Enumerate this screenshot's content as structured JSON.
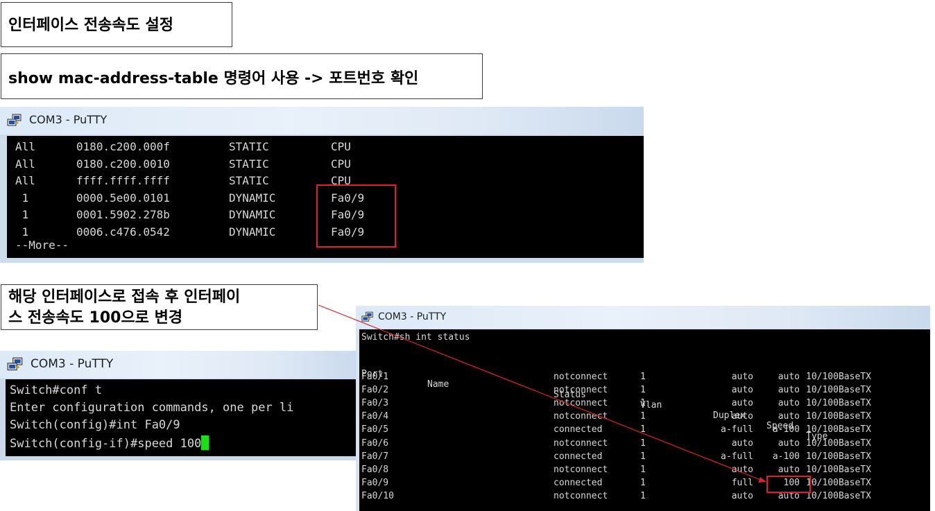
{
  "labels": {
    "title": "인터페이스 전송속도 설정",
    "show_cmd": "show mac-address-table 명령어 사용 -> 포트번호 확인",
    "step_line1": "해당 인터페이스로 접속 후 인터페이",
    "step_line2": "스 전송속도 100으로 변경"
  },
  "window_title": "COM3 - PuTTY",
  "colors": {
    "highlight_box": "#e0202a",
    "cursor": "#19e019",
    "terminal_bg": "#000000",
    "terminal_fg": "#d8d8d8"
  },
  "mac_table": {
    "rows": [
      {
        "vlan": "All",
        "mac": "0180.c200.000f",
        "type": "STATIC",
        "port": "CPU"
      },
      {
        "vlan": "All",
        "mac": "0180.c200.0010",
        "type": "STATIC",
        "port": "CPU"
      },
      {
        "vlan": "All",
        "mac": "ffff.ffff.ffff",
        "type": "STATIC",
        "port": "CPU"
      },
      {
        "vlan": " 1",
        "mac": "0000.5e00.0101",
        "type": "DYNAMIC",
        "port": "Fa0/9"
      },
      {
        "vlan": " 1",
        "mac": "0001.5902.278b",
        "type": "DYNAMIC",
        "port": "Fa0/9"
      },
      {
        "vlan": " 1",
        "mac": "0006.c476.0542",
        "type": "DYNAMIC",
        "port": "Fa0/9"
      }
    ],
    "more": "--More--"
  },
  "config_session": {
    "lines": [
      "Switch#conf t",
      "Enter configuration commands, one per li",
      "Switch(config)#int Fa0/9",
      "Switch(config-if)#speed 100"
    ]
  },
  "int_status": {
    "command": "Switch#sh int status",
    "headers": {
      "port": "Port",
      "name": "Name",
      "status": "Status",
      "vlan": "Vlan",
      "duplex": "Duplex",
      "speed": "Speed",
      "type": "Type"
    },
    "rows": [
      {
        "port": "Fa0/1",
        "status": "notconnect",
        "vlan": "1",
        "duplex": "auto",
        "speed": "auto",
        "type": "10/100BaseTX"
      },
      {
        "port": "Fa0/2",
        "status": "notconnect",
        "vlan": "1",
        "duplex": "auto",
        "speed": "auto",
        "type": "10/100BaseTX"
      },
      {
        "port": "Fa0/3",
        "status": "notconnect",
        "vlan": "1",
        "duplex": "auto",
        "speed": "auto",
        "type": "10/100BaseTX"
      },
      {
        "port": "Fa0/4",
        "status": "notconnect",
        "vlan": "1",
        "duplex": "auto",
        "speed": "auto",
        "type": "10/100BaseTX"
      },
      {
        "port": "Fa0/5",
        "status": "connected",
        "vlan": "1",
        "duplex": "a-full",
        "speed": "a-100",
        "type": "10/100BaseTX"
      },
      {
        "port": "Fa0/6",
        "status": "notconnect",
        "vlan": "1",
        "duplex": "auto",
        "speed": "auto",
        "type": "10/100BaseTX"
      },
      {
        "port": "Fa0/7",
        "status": "connected",
        "vlan": "1",
        "duplex": "a-full",
        "speed": "a-100",
        "type": "10/100BaseTX"
      },
      {
        "port": "Fa0/8",
        "status": "notconnect",
        "vlan": "1",
        "duplex": "auto",
        "speed": "auto",
        "type": "10/100BaseTX"
      },
      {
        "port": "Fa0/9",
        "status": "connected",
        "vlan": "1",
        "duplex": "full",
        "speed": "100",
        "type": "10/100BaseTX"
      },
      {
        "port": "Fa0/10",
        "status": "notconnect",
        "vlan": "1",
        "duplex": "auto",
        "speed": "auto",
        "type": "10/100BaseTX"
      }
    ]
  }
}
